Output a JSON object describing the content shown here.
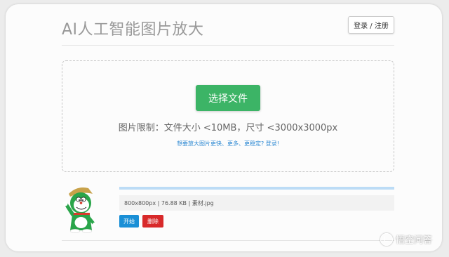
{
  "header": {
    "title": "AI人工智能图片放大",
    "login_label": "登录 / 注册"
  },
  "upload": {
    "choose_label": "选择文件",
    "limit_text": "图片限制：文件大小 <10MB，尺寸 <3000x3000px",
    "upsell_text": "想要放大图片更快、更多、更稳定? 登录!"
  },
  "file": {
    "info": "800x800px | 76.88 KB | 素材.jpg",
    "progress": 1.0,
    "start_label": "开始",
    "delete_label": "删除"
  },
  "watermark": {
    "text": "悟空问答"
  },
  "colors": {
    "primary_green": "#3cb466",
    "start_blue": "#1a8fd6",
    "delete_red": "#d8292a",
    "link_blue": "#2f8ad3"
  }
}
